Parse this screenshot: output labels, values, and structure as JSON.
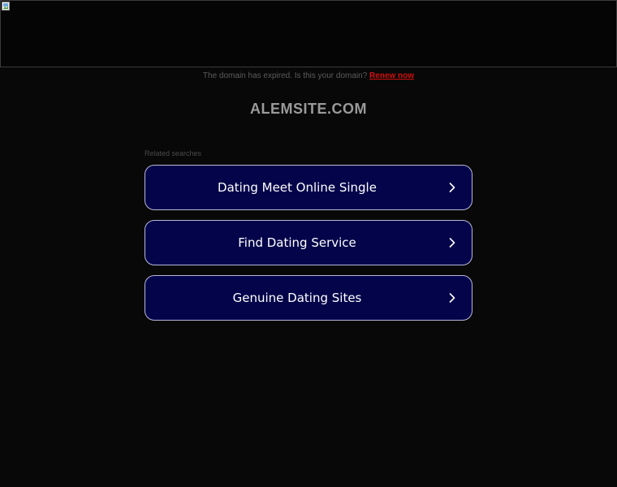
{
  "notice": {
    "text": "The domain has expired. Is this your domain?",
    "link_label": "Renew now"
  },
  "domain": {
    "title": "ALEMSITE.COM"
  },
  "related": {
    "label": "Related searches",
    "items": [
      {
        "label": "Dating Meet Online Single",
        "icon": "chevron-right-icon"
      },
      {
        "label": "Find Dating Service",
        "icon": "chevron-right-icon"
      },
      {
        "label": "Genuine Dating Sites",
        "icon": "chevron-right-icon"
      }
    ]
  },
  "colors": {
    "background": "#080808",
    "button_fill": "#03044a",
    "button_border": "#b9b9d8",
    "link": "#d10f0f"
  }
}
